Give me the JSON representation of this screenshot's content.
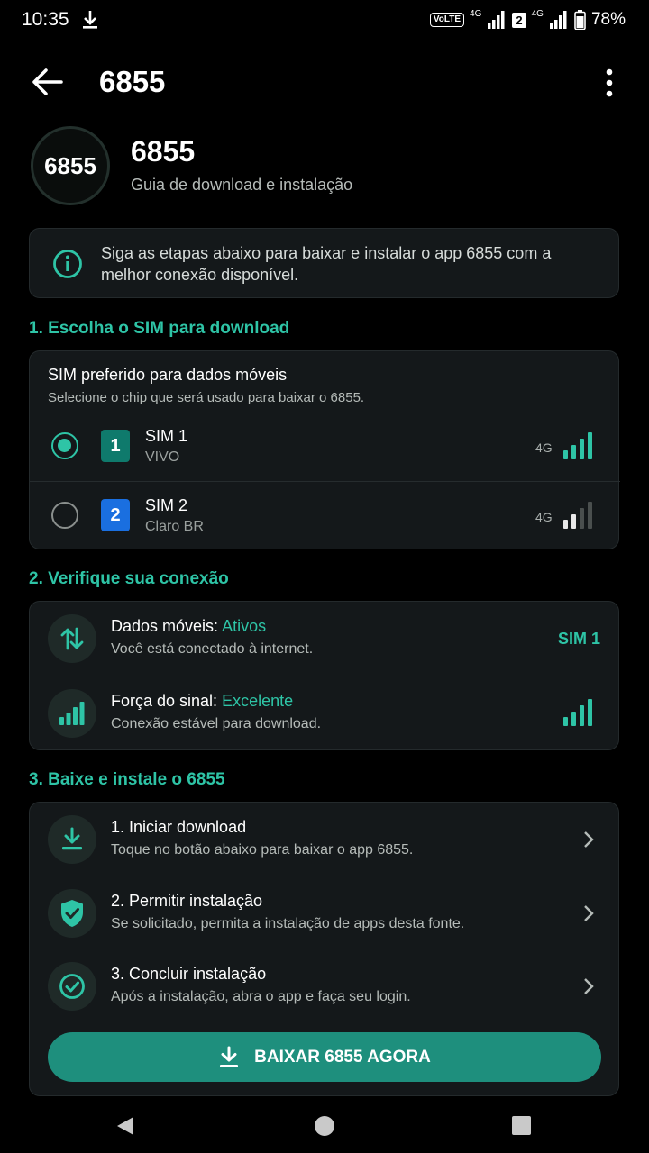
{
  "status_bar": {
    "time": "10:35",
    "volte": "VoLTE",
    "net1": "4G",
    "sim_slot": "2",
    "net2": "4G",
    "battery_pct": "78%"
  },
  "app_bar": {
    "title": "6855"
  },
  "header": {
    "logo_text": "6855",
    "title": "6855",
    "subtitle": "Guia de download e instalação"
  },
  "info": {
    "text": "Siga as etapas abaixo para baixar e instalar o app 6855 com a melhor conexão disponível."
  },
  "section1": {
    "title": "1. Escolha o SIM para download",
    "card_title": "SIM preferido para dados móveis",
    "card_sub": "Selecione o chip que será usado para baixar o 6855.",
    "sims": [
      {
        "badge": "1",
        "name": "SIM 1",
        "operator": "VIVO",
        "tech": "4G",
        "selected": true,
        "signal_bars": 4,
        "color": "#0f7a6c"
      },
      {
        "badge": "2",
        "name": "SIM 2",
        "operator": "Claro BR",
        "tech": "4G",
        "selected": false,
        "signal_bars": 2,
        "color": "#1a6fe0"
      }
    ]
  },
  "section2": {
    "title": "2. Verifique sua conexão",
    "data_label": "Dados móveis: ",
    "data_value": "Ativos",
    "data_sub": "Você está conectado à internet.",
    "data_sim": "SIM 1",
    "signal_label": "Força do sinal: ",
    "signal_value": "Excelente",
    "signal_sub": "Conexão estável para download.",
    "signal_bars": 4
  },
  "section3": {
    "title": "3. Baixe e instale o 6855",
    "steps": [
      {
        "title": "1. Iniciar download",
        "sub": "Toque no botão abaixo para baixar o app 6855.",
        "icon": "download-icon"
      },
      {
        "title": "2. Permitir instalação",
        "sub": "Se solicitado, permita a instalação de apps desta fonte.",
        "icon": "shield-check-icon"
      },
      {
        "title": "3. Concluir instalação",
        "sub": "Após a instalação, abra o app e faça seu login.",
        "icon": "check-circle-icon"
      }
    ],
    "button_label": "BAIXAR 6855 AGORA"
  },
  "colors": {
    "accent": "#2ec4a6",
    "button": "#1e8f7d",
    "card": "#14181a"
  }
}
